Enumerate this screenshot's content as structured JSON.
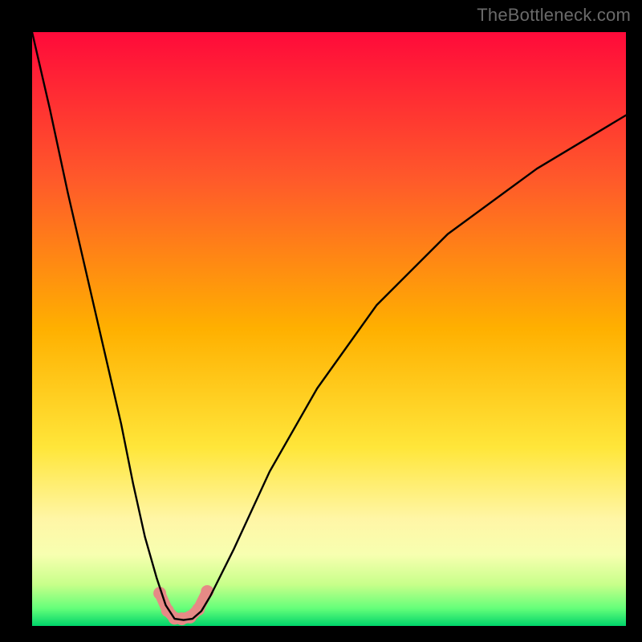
{
  "watermark": "TheBottleneck.com",
  "chart_data": {
    "type": "line",
    "title": "",
    "xlabel": "",
    "ylabel": "",
    "xlim": [
      0,
      100
    ],
    "ylim": [
      0,
      100
    ],
    "background_gradient": {
      "stops": [
        {
          "pct": 0,
          "color": "#ff0a3a"
        },
        {
          "pct": 25,
          "color": "#ff5a2a"
        },
        {
          "pct": 50,
          "color": "#ffb000"
        },
        {
          "pct": 70,
          "color": "#ffe63a"
        },
        {
          "pct": 82,
          "color": "#fff6a6"
        },
        {
          "pct": 88,
          "color": "#f7ffb0"
        },
        {
          "pct": 93,
          "color": "#c8ff8a"
        },
        {
          "pct": 97,
          "color": "#66ff7a"
        },
        {
          "pct": 100,
          "color": "#00d46a"
        }
      ]
    },
    "series": [
      {
        "name": "bottleneck-curve",
        "x": [
          0,
          3,
          6,
          9,
          12,
          15,
          17,
          19,
          21,
          22.5,
          24,
          25.5,
          27,
          28.5,
          30,
          34,
          40,
          48,
          58,
          70,
          85,
          100
        ],
        "y": [
          100,
          87,
          73,
          60,
          47,
          34,
          24,
          15,
          8,
          3.5,
          1.2,
          1.0,
          1.2,
          2.5,
          5,
          13,
          26,
          40,
          54,
          66,
          77,
          86
        ]
      }
    ],
    "markers": {
      "name": "highlight-points",
      "color": "#e68a86",
      "radius": 8,
      "x": [
        21.5,
        22.8,
        24.0,
        25.2,
        26.6,
        28.0,
        29.5
      ],
      "y": [
        5.5,
        2.6,
        1.3,
        1.2,
        1.5,
        2.8,
        5.8
      ]
    },
    "highlight_segment": {
      "name": "highlight-u",
      "color": "#e68a86",
      "width": 14,
      "x": [
        21.5,
        22.8,
        24.0,
        25.2,
        26.6,
        28.0,
        29.5
      ],
      "y": [
        5.5,
        2.6,
        1.3,
        1.2,
        1.5,
        2.8,
        5.8
      ]
    }
  }
}
